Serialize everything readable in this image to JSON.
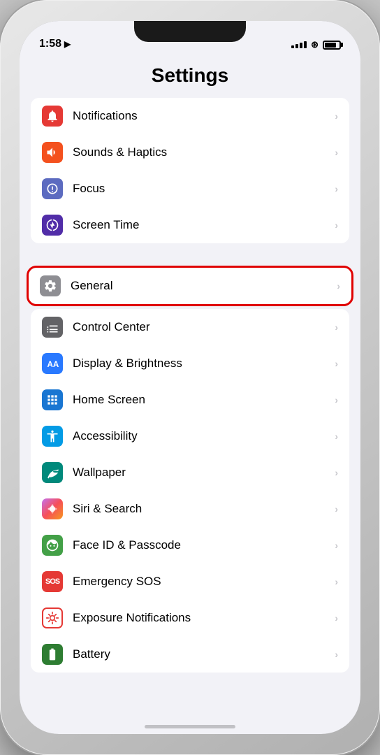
{
  "statusBar": {
    "time": "1:58",
    "locationIcon": "▶",
    "signalBars": [
      3,
      5,
      7,
      9,
      11
    ],
    "wifiIcon": "wifi",
    "battery": 80
  },
  "page": {
    "title": "Settings"
  },
  "group1": {
    "items": [
      {
        "id": "notifications",
        "label": "Notifications",
        "iconColor": "icon-red",
        "iconType": "bell"
      },
      {
        "id": "sounds-haptics",
        "label": "Sounds & Haptics",
        "iconColor": "icon-orange-red",
        "iconType": "speaker"
      },
      {
        "id": "focus",
        "label": "Focus",
        "iconColor": "icon-purple",
        "iconType": "moon"
      },
      {
        "id": "screen-time",
        "label": "Screen Time",
        "iconColor": "icon-indigo",
        "iconType": "hourglass"
      }
    ]
  },
  "group2": {
    "highlighted": true,
    "items": [
      {
        "id": "general",
        "label": "General",
        "iconColor": "icon-gray",
        "iconType": "gear",
        "highlighted": true
      },
      {
        "id": "control-center",
        "label": "Control Center",
        "iconColor": "icon-gray2",
        "iconType": "sliders"
      },
      {
        "id": "display-brightness",
        "label": "Display & Brightness",
        "iconColor": "icon-blue",
        "iconType": "aa"
      },
      {
        "id": "home-screen",
        "label": "Home Screen",
        "iconColor": "icon-blue2",
        "iconType": "grid"
      },
      {
        "id": "accessibility",
        "label": "Accessibility",
        "iconColor": "icon-light-blue",
        "iconType": "accessibility"
      },
      {
        "id": "wallpaper",
        "label": "Wallpaper",
        "iconColor": "icon-teal",
        "iconType": "flower"
      },
      {
        "id": "siri-search",
        "label": "Siri & Search",
        "iconColor": "icon-pink",
        "iconType": "siri"
      },
      {
        "id": "face-id",
        "label": "Face ID & Passcode",
        "iconColor": "icon-green",
        "iconType": "faceid"
      },
      {
        "id": "emergency-sos",
        "label": "Emergency SOS",
        "iconColor": "icon-red",
        "iconType": "sos"
      },
      {
        "id": "exposure",
        "label": "Exposure Notifications",
        "iconColor": "icon-red",
        "iconType": "exposure"
      },
      {
        "id": "battery",
        "label": "Battery",
        "iconColor": "icon-green2",
        "iconType": "battery"
      }
    ]
  },
  "chevron": "›"
}
